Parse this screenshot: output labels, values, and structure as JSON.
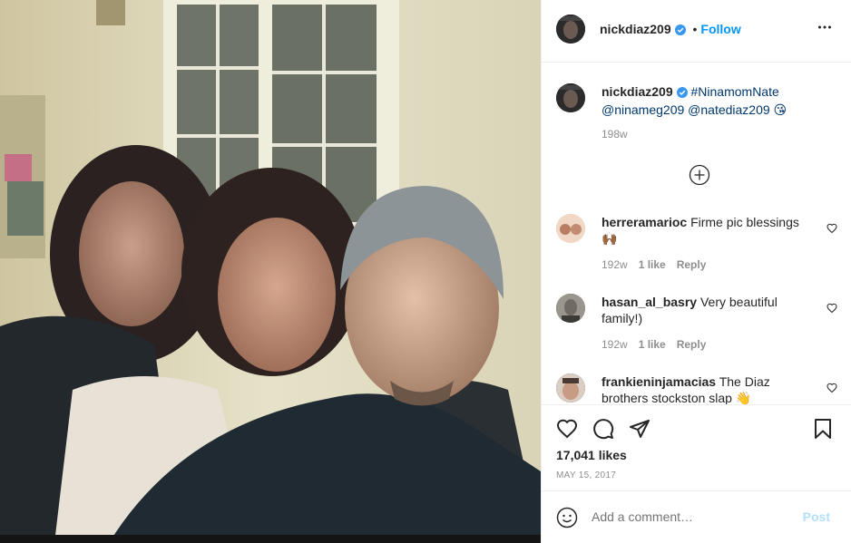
{
  "header": {
    "username": "nickdiaz209",
    "separator": "•",
    "follow_label": "Follow",
    "more_label": "•••"
  },
  "caption": {
    "username": "nickdiaz209",
    "line1": "#NinamomNate",
    "line2": "@ninameg209 @natediaz209 😘",
    "time": "198w"
  },
  "load_more_icon": "plus-circle-icon",
  "comments": [
    {
      "username": "herreramarioc",
      "text": "Firme pic blessings",
      "emoji": "🙌🏾",
      "time": "192w",
      "likes": "1 like",
      "reply": "Reply"
    },
    {
      "username": "hasan_al_basry",
      "text": "Very beautiful family!)",
      "time": "192w",
      "likes": "1 like",
      "reply": "Reply"
    },
    {
      "username": "frankieninjamacias",
      "text": "The Diaz brothers stockston slap",
      "emoji": "👋"
    }
  ],
  "actions": {
    "likes": "17,041 likes",
    "date": "MAY 15, 2017"
  },
  "add_comment": {
    "placeholder": "Add a comment…",
    "post_label": "Post"
  },
  "colors": {
    "accent": "#0095f6",
    "verified": "#3897f0",
    "muted": "#8e8e8e",
    "post_disabled": "#b2dffc"
  }
}
